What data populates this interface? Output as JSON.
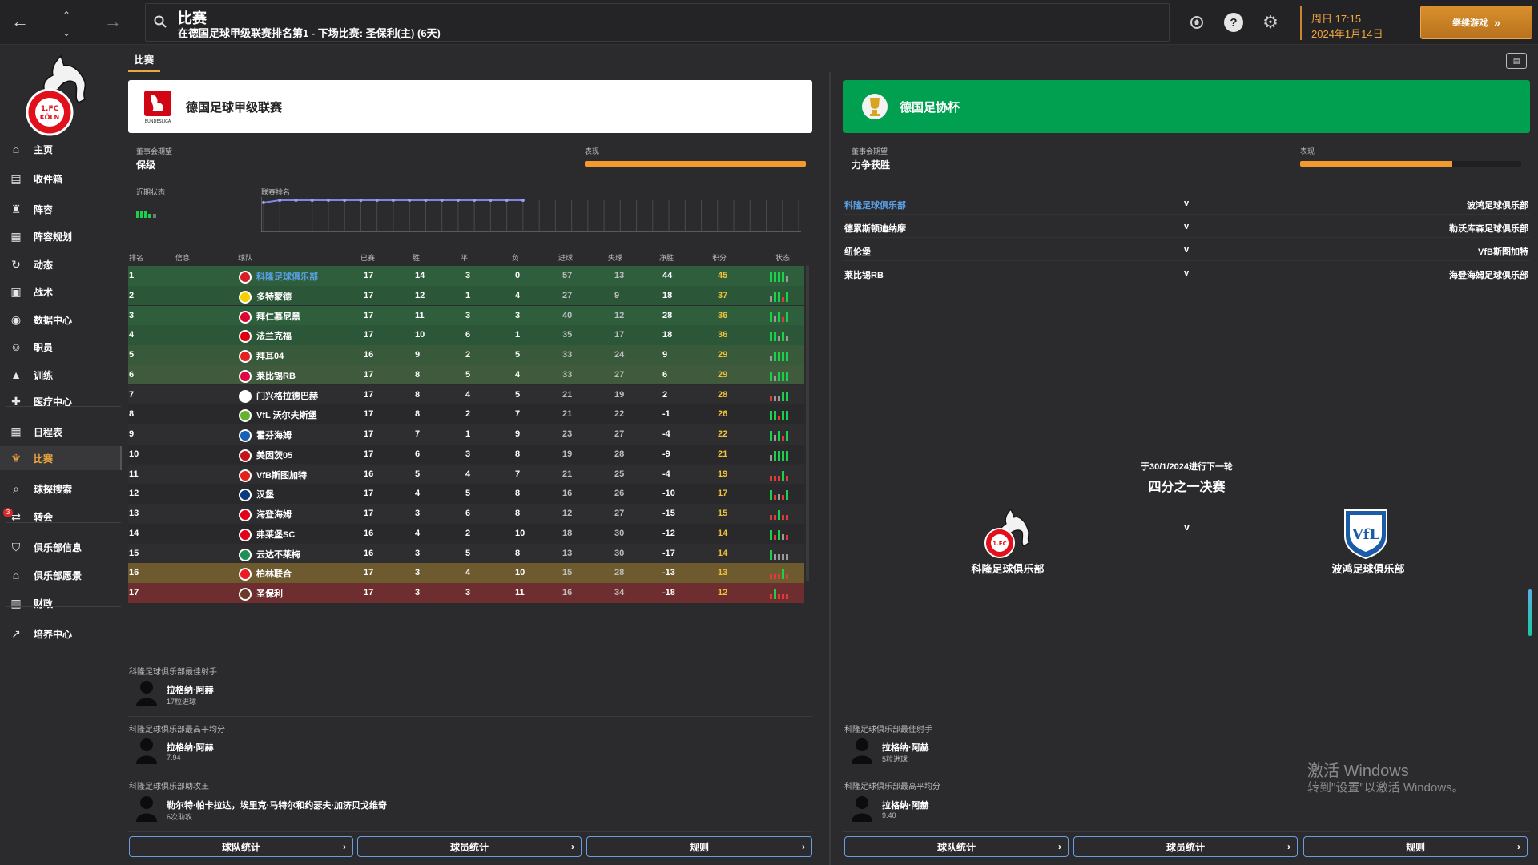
{
  "topbar": {
    "search_title": "比赛",
    "search_subtitle": "在德国足球甲级联赛排名第1 - 下场比赛: 圣保利(主) (6天)",
    "date_line1": "周日 17:15",
    "date_line2": "2024年1月14日",
    "continue_label": "继续游戏"
  },
  "sidebar": {
    "items": [
      {
        "label": "主页",
        "icon": "home-icon"
      },
      {
        "label": "收件箱",
        "icon": "inbox-icon"
      },
      {
        "label": "阵容",
        "icon": "jersey-icon"
      },
      {
        "label": "阵容规划",
        "icon": "clipboard-icon"
      },
      {
        "label": "动态",
        "icon": "dynamics-icon"
      },
      {
        "label": "战术",
        "icon": "tactics-icon"
      },
      {
        "label": "数据中心",
        "icon": "data-icon"
      },
      {
        "label": "职员",
        "icon": "staff-icon"
      },
      {
        "label": "训练",
        "icon": "training-icon"
      },
      {
        "label": "医疗中心",
        "icon": "medical-icon"
      },
      {
        "label": "日程表",
        "icon": "calendar-icon"
      },
      {
        "label": "比赛",
        "icon": "trophy-icon"
      },
      {
        "label": "球探搜索",
        "icon": "scout-icon"
      },
      {
        "label": "转会",
        "icon": "transfer-icon"
      },
      {
        "label": "俱乐部信息",
        "icon": "shield-icon"
      },
      {
        "label": "俱乐部愿景",
        "icon": "vision-icon"
      },
      {
        "label": "财政",
        "icon": "finance-icon"
      },
      {
        "label": "培养中心",
        "icon": "development-icon"
      }
    ],
    "transfer_badge": "3"
  },
  "tabs": {
    "competitions": "比赛"
  },
  "league": {
    "name": "德国足球甲级联赛",
    "logo_text": "BUNDESLIGA",
    "expectation_label": "董事会期望",
    "expectation_value": "保级",
    "performance_label": "表现",
    "performance_pct": 1.0,
    "form_label": "近期状态",
    "position_label": "联赛排名",
    "columns": [
      "排名",
      "信息",
      "球队",
      "已赛",
      "胜",
      "平",
      "负",
      "进球",
      "失球",
      "净胜",
      "积分",
      "状态"
    ],
    "table": [
      {
        "pos": "1",
        "team": "科隆足球俱乐部",
        "p": "17",
        "w": "14",
        "d": "3",
        "l": "0",
        "gf": "57",
        "ga": "13",
        "gd": "44",
        "pts": "45",
        "zone": "cl",
        "badge": "#d51f26",
        "form": "WWWWD"
      },
      {
        "pos": "2",
        "team": "多特蒙德",
        "p": "17",
        "w": "12",
        "d": "1",
        "l": "4",
        "gf": "27",
        "ga": "9",
        "gd": "18",
        "pts": "37",
        "zone": "cl",
        "badge": "#f5d000",
        "form": "DWWLW"
      },
      {
        "pos": "3",
        "team": "拜仁慕尼黑",
        "p": "17",
        "w": "11",
        "d": "3",
        "l": "3",
        "gf": "40",
        "ga": "12",
        "gd": "28",
        "pts": "36",
        "zone": "cl",
        "badge": "#dc052d",
        "form": "WDWLW"
      },
      {
        "pos": "4",
        "team": "法兰克福",
        "p": "17",
        "w": "10",
        "d": "6",
        "l": "1",
        "gf": "35",
        "ga": "17",
        "gd": "18",
        "pts": "36",
        "zone": "cl",
        "badge": "#e1000f",
        "form": "WWDWD"
      },
      {
        "pos": "5",
        "team": "拜耳04",
        "p": "16",
        "w": "9",
        "d": "2",
        "l": "5",
        "gf": "33",
        "ga": "24",
        "gd": "9",
        "pts": "29",
        "zone": "el",
        "badge": "#e32221",
        "form": "DWWWW"
      },
      {
        "pos": "6",
        "team": "莱比锡RB",
        "p": "17",
        "w": "8",
        "d": "5",
        "l": "4",
        "gf": "33",
        "ga": "27",
        "gd": "6",
        "pts": "29",
        "zone": "ecl",
        "badge": "#dd0741",
        "form": "WDWWW"
      },
      {
        "pos": "7",
        "team": "门兴格拉德巴赫",
        "p": "17",
        "w": "8",
        "d": "4",
        "l": "5",
        "gf": "21",
        "ga": "19",
        "gd": "2",
        "pts": "28",
        "zone": "",
        "badge": "#ffffff",
        "form": "LDDWW"
      },
      {
        "pos": "8",
        "team": "VfL 沃尔夫斯堡",
        "p": "17",
        "w": "8",
        "d": "2",
        "l": "7",
        "gf": "21",
        "ga": "22",
        "gd": "-1",
        "pts": "26",
        "zone": "",
        "badge": "#65b32e",
        "form": "WWLWW"
      },
      {
        "pos": "9",
        "team": "霍芬海姆",
        "p": "17",
        "w": "7",
        "d": "1",
        "l": "9",
        "gf": "23",
        "ga": "27",
        "gd": "-4",
        "pts": "22",
        "zone": "",
        "badge": "#1961b5",
        "form": "WDWLW"
      },
      {
        "pos": "10",
        "team": "美因茨05",
        "p": "17",
        "w": "6",
        "d": "3",
        "l": "8",
        "gf": "19",
        "ga": "28",
        "gd": "-9",
        "pts": "21",
        "zone": "",
        "badge": "#c3141e",
        "form": "DWWWW"
      },
      {
        "pos": "11",
        "team": "VfB斯图加特",
        "p": "16",
        "w": "5",
        "d": "4",
        "l": "7",
        "gf": "21",
        "ga": "25",
        "gd": "-4",
        "pts": "19",
        "zone": "",
        "badge": "#e32219",
        "form": "LLLWL"
      },
      {
        "pos": "12",
        "team": "汉堡",
        "p": "17",
        "w": "4",
        "d": "5",
        "l": "8",
        "gf": "16",
        "ga": "26",
        "gd": "-10",
        "pts": "17",
        "zone": "",
        "badge": "#0a3b7c",
        "form": "WLDLW"
      },
      {
        "pos": "13",
        "team": "海登海姆",
        "p": "17",
        "w": "3",
        "d": "6",
        "l": "8",
        "gf": "12",
        "ga": "27",
        "gd": "-15",
        "pts": "15",
        "zone": "",
        "badge": "#e2001a",
        "form": "LLWLL"
      },
      {
        "pos": "14",
        "team": "弗莱堡SC",
        "p": "16",
        "w": "4",
        "d": "2",
        "l": "10",
        "gf": "18",
        "ga": "30",
        "gd": "-12",
        "pts": "14",
        "zone": "",
        "badge": "#e2001a",
        "form": "WLWDL"
      },
      {
        "pos": "15",
        "team": "云达不莱梅",
        "p": "16",
        "w": "3",
        "d": "5",
        "l": "8",
        "gf": "13",
        "ga": "30",
        "gd": "-17",
        "pts": "14",
        "zone": "",
        "badge": "#1d9053",
        "form": "WDDDD"
      },
      {
        "pos": "16",
        "team": "柏林联合",
        "p": "17",
        "w": "3",
        "d": "4",
        "l": "10",
        "gf": "15",
        "ga": "28",
        "gd": "-13",
        "pts": "13",
        "zone": "po",
        "badge": "#eb1923",
        "form": "LLLWL"
      },
      {
        "pos": "17",
        "team": "圣保利",
        "p": "17",
        "w": "3",
        "d": "3",
        "l": "11",
        "gf": "16",
        "ga": "34",
        "gd": "-18",
        "pts": "12",
        "zone": "rel",
        "badge": "#6b3b2a",
        "form": "LWLLL"
      }
    ],
    "top_scorer_title": "科隆足球俱乐部最佳射手",
    "top_scorer_name": "拉格纳·阿赫",
    "top_scorer_note": "17粒进球",
    "top_rating_title": "科隆足球俱乐部最高平均分",
    "top_rating_name": "拉格纳·阿赫",
    "top_rating_note": "7.94",
    "top_assist_title": "科隆足球俱乐部助攻王",
    "top_assist_name": "勒尔特·帕卡拉达，埃里克·马特尔和约瑟夫·加济贝戈维奇",
    "top_assist_note": "6次助攻",
    "btn_team_stats": "球队统计",
    "btn_player_stats": "球员统计",
    "btn_rules": "规则"
  },
  "cup": {
    "name": "德国足协杯",
    "expectation_label": "董事会期望",
    "expectation_value": "力争获胜",
    "performance_label": "表现",
    "performance_pct": 0.69,
    "fixtures": [
      {
        "home": "科隆足球俱乐部",
        "vs": "v",
        "away": "波鸿足球俱乐部",
        "highlight": true
      },
      {
        "home": "德累斯顿迪纳摩",
        "vs": "v",
        "away": "勒沃库森足球俱乐部",
        "highlight": false
      },
      {
        "home": "纽伦堡",
        "vs": "v",
        "away": "VfB斯图加特",
        "highlight": false
      },
      {
        "home": "莱比锡RB",
        "vs": "v",
        "away": "海登海姆足球俱乐部",
        "highlight": false
      }
    ],
    "next_round_date": "于30/1/2024进行下一轮",
    "next_round_name": "四分之一决赛",
    "match_home": "科隆足球俱乐部",
    "match_vs": "v",
    "match_away": "波鸿足球俱乐部",
    "top_scorer_title": "科隆足球俱乐部最佳射手",
    "top_scorer_name": "拉格纳·阿赫",
    "top_scorer_note": "5粒进球",
    "top_rating_title": "科隆足球俱乐部最高平均分",
    "top_rating_name": "拉格纳·阿赫",
    "top_rating_note": "9.40",
    "btn_team_stats": "球队统计",
    "btn_player_stats": "球员统计",
    "btn_rules": "规则"
  },
  "watermark": {
    "line1": "激活 Windows",
    "line2": "转到\"设置\"以激活 Windows。"
  },
  "colors": {
    "accent": "#f0a640",
    "league_header": "#ffffff",
    "cup_header": "#00a050",
    "link": "#5aa0e6"
  }
}
